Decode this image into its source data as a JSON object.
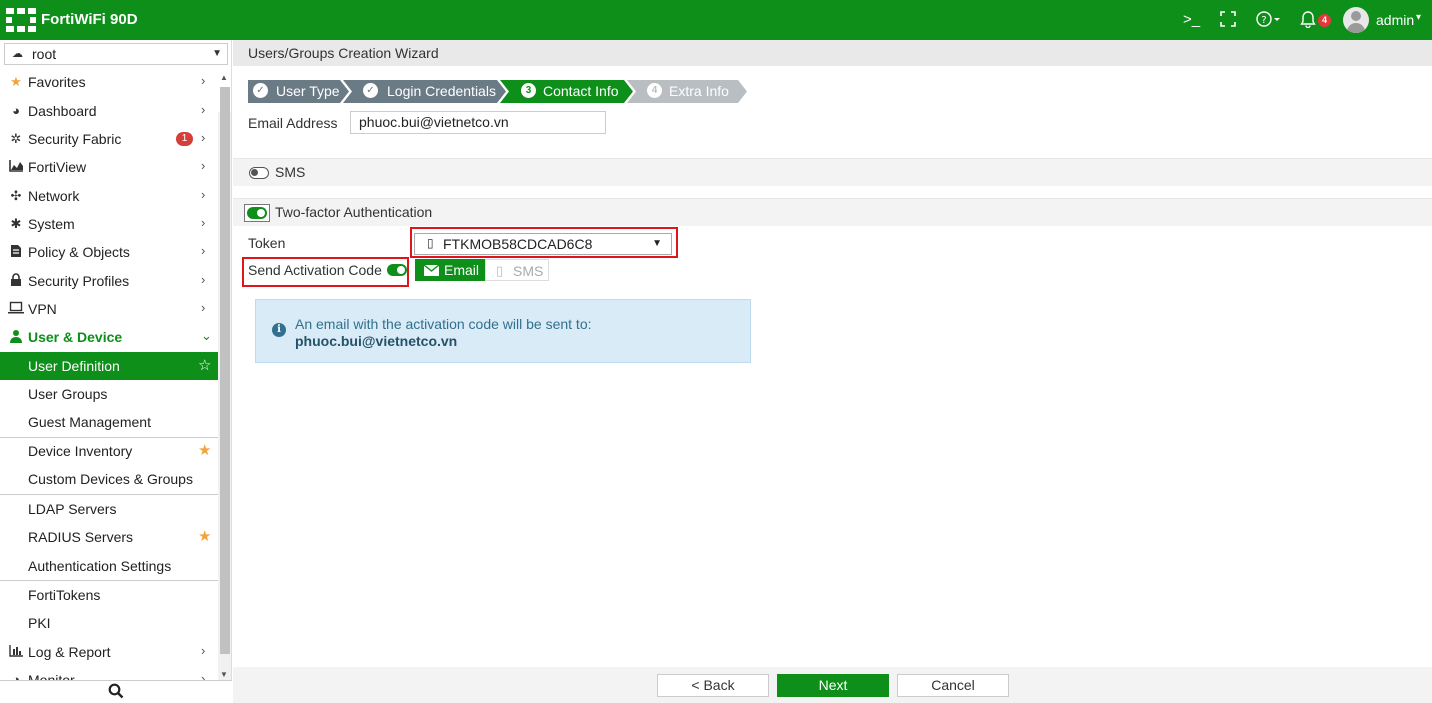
{
  "topbar": {
    "title": "FortiWiFi 90D",
    "cli_icon": "cli-console-icon",
    "fullscreen_icon": "fullscreen-icon",
    "help_icon": "help-icon",
    "notifications_icon": "bell-icon",
    "notifications_count": "4",
    "user": "admin"
  },
  "sidebar": {
    "vdom": "root",
    "nav": [
      {
        "label": "Favorites",
        "icon": "star-icon"
      },
      {
        "label": "Dashboard",
        "icon": "dashboard-icon"
      },
      {
        "label": "Security Fabric",
        "icon": "fabric-icon",
        "badge": "1"
      },
      {
        "label": "FortiView",
        "icon": "chart-icon"
      },
      {
        "label": "Network",
        "icon": "network-icon"
      },
      {
        "label": "System",
        "icon": "gear-icon"
      },
      {
        "label": "Policy & Objects",
        "icon": "policy-icon"
      },
      {
        "label": "Security Profiles",
        "icon": "lock-icon"
      },
      {
        "label": "VPN",
        "icon": "laptop-icon"
      },
      {
        "label": "User & Device",
        "icon": "user-icon"
      }
    ],
    "sub": [
      {
        "label": "User Definition"
      },
      {
        "label": "User Groups"
      },
      {
        "label": "Guest Management"
      },
      {
        "label": "Device Inventory"
      },
      {
        "label": "Custom Devices & Groups"
      },
      {
        "label": "LDAP Servers"
      },
      {
        "label": "RADIUS Servers"
      },
      {
        "label": "Authentication Settings"
      },
      {
        "label": "FortiTokens"
      },
      {
        "label": "PKI"
      }
    ],
    "tail": [
      {
        "label": "Log & Report",
        "icon": "bar-chart-icon"
      },
      {
        "label": "Monitor",
        "icon": "monitor-icon"
      }
    ]
  },
  "page": {
    "title": "Users/Groups Creation Wizard",
    "steps": [
      {
        "label": "User Type",
        "marker": "✓"
      },
      {
        "label": "Login Credentials",
        "marker": "✓"
      },
      {
        "label": "Contact Info",
        "marker": "3"
      },
      {
        "label": "Extra Info",
        "marker": "4"
      }
    ],
    "email_label": "Email Address",
    "email_value": "phuoc.bui@vietnetco.vn",
    "sms_label": "SMS",
    "sms_enabled": false,
    "two_factor_label": "Two-factor Authentication",
    "two_factor_enabled": true,
    "token_label": "Token",
    "token_value": "FTKMOB58CDCAD6C8",
    "send_activation_label": "Send Activation Code",
    "send_activation_enabled": true,
    "send_via_email": "Email",
    "send_via_sms": "SMS",
    "info_text": "An email with the activation code will be sent to:",
    "info_email": "phuoc.bui@vietnetco.vn"
  },
  "footer": {
    "back": "< Back",
    "next": "Next",
    "cancel": "Cancel"
  },
  "colors": {
    "brand_green": "#0d8f1a",
    "step_inactive": "#6b7b86",
    "highlight_red": "#e0141b",
    "info_bg": "#d9ebf7"
  }
}
